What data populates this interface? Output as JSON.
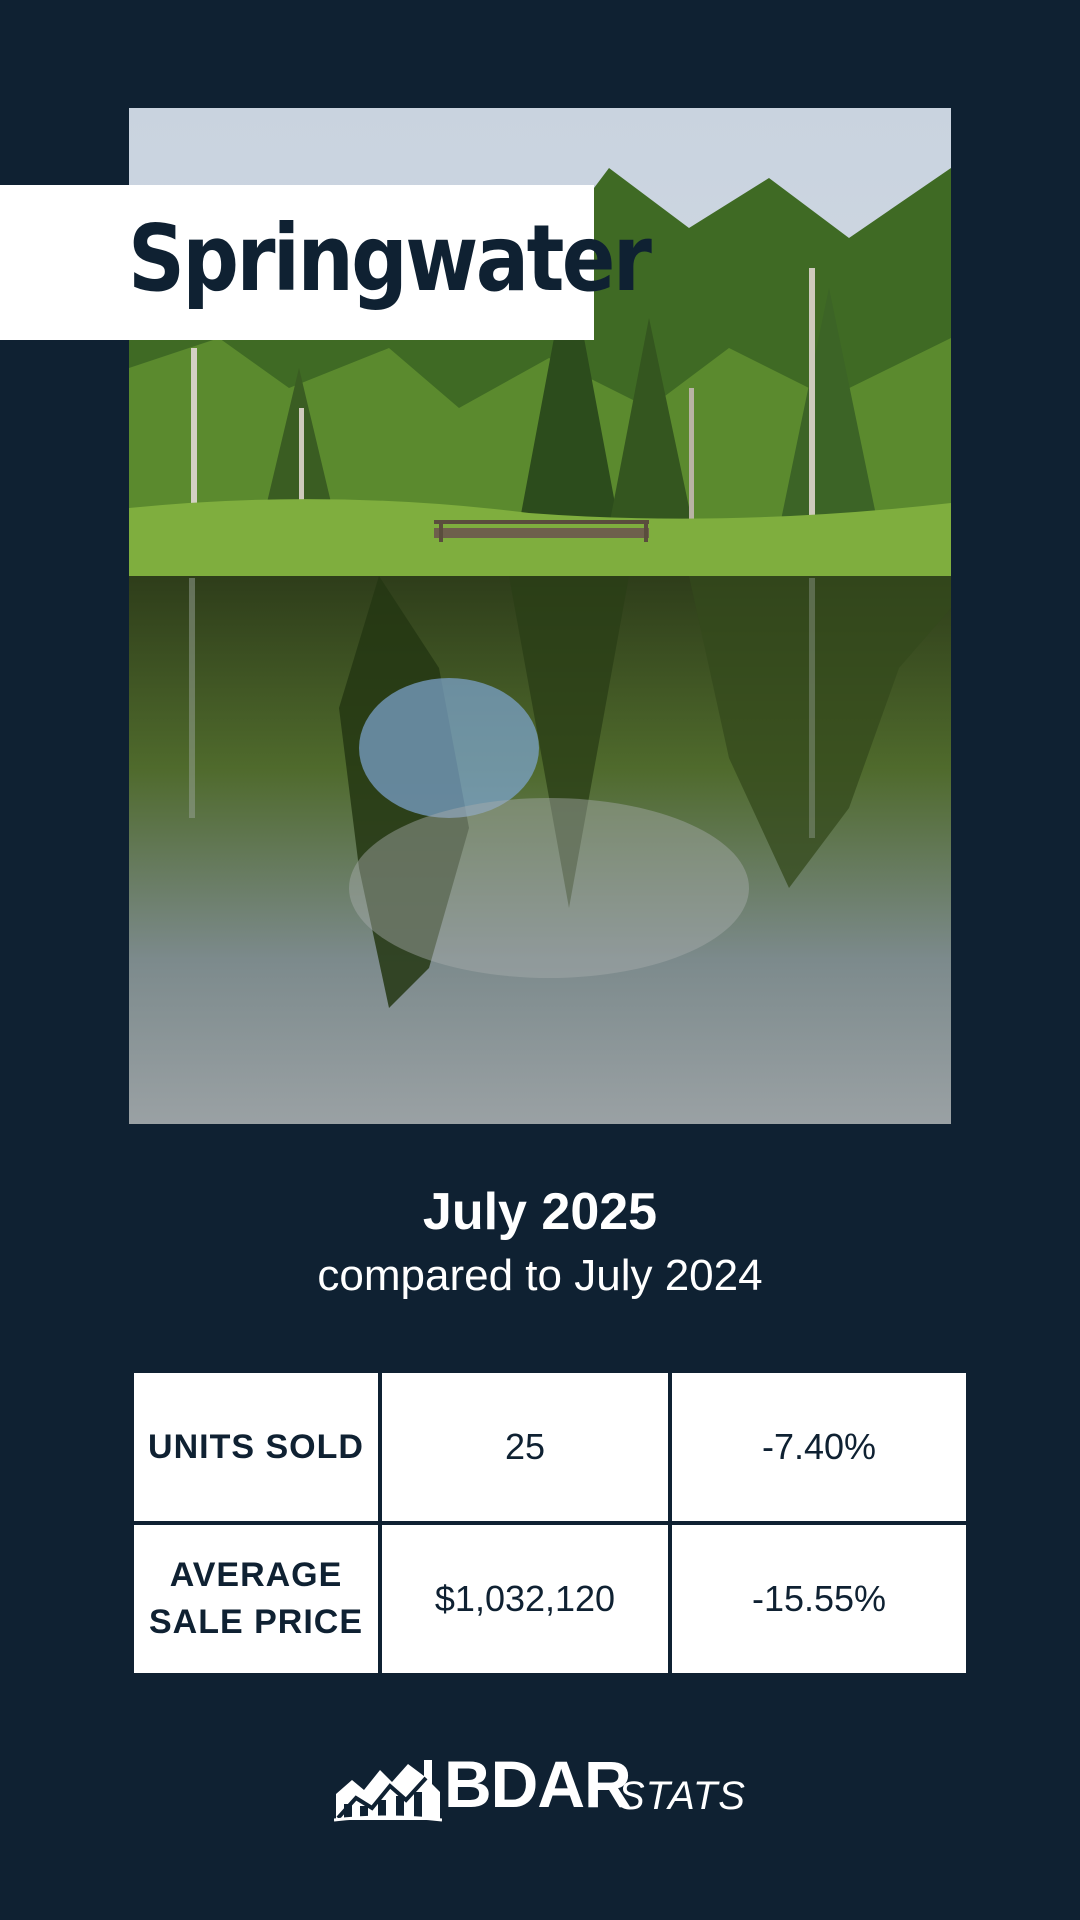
{
  "title": "Springwater",
  "period": {
    "main": "July 2025",
    "comparison": "compared to July 2024"
  },
  "stats": [
    {
      "label": "UNITS SOLD",
      "value": "25",
      "change": "-7.40%"
    },
    {
      "label": "AVERAGE SALE PRICE",
      "value": "$1,032,120",
      "change": "-15.55%"
    }
  ],
  "logo": {
    "bold": "BDAR",
    "italic": "STATS",
    "icon": "house-chart-icon"
  },
  "colors": {
    "background": "#0f2132",
    "panel": "#ffffff",
    "text_dark": "#0f2132"
  }
}
